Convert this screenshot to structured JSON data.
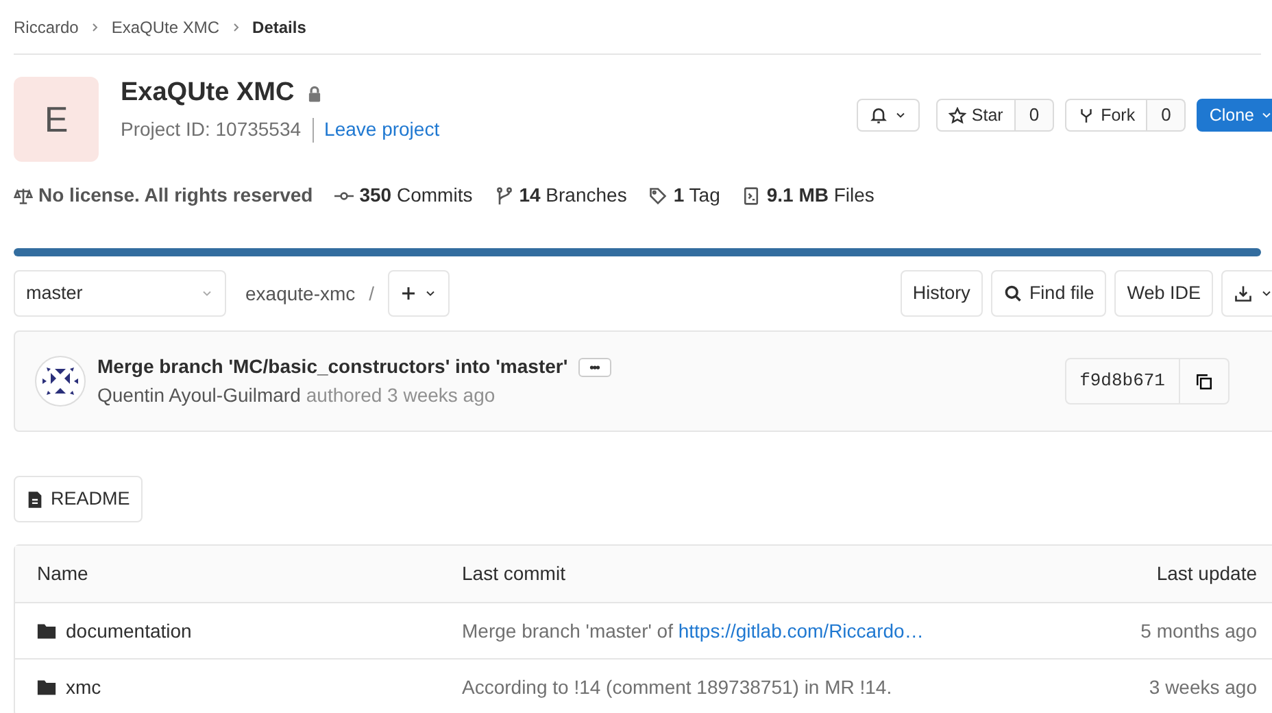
{
  "breadcrumb": [
    {
      "label": "Riccardo",
      "current": false
    },
    {
      "label": "ExaQUte XMC",
      "current": false
    },
    {
      "label": "Details",
      "current": true
    }
  ],
  "project": {
    "avatar_letter": "E",
    "name": "ExaQUte XMC",
    "private": true,
    "id_text": "Project ID: 10735534",
    "leave_link": "Leave project"
  },
  "actions": {
    "star": {
      "label": "Star",
      "count": "0"
    },
    "fork": {
      "label": "Fork",
      "count": "0"
    },
    "clone": "Clone"
  },
  "stats": [
    {
      "kind": "license",
      "value": "No license. All rights reserved"
    },
    {
      "kind": "commits",
      "value": "350",
      "label": "Commits"
    },
    {
      "kind": "branches",
      "value": "14",
      "label": "Branches"
    },
    {
      "kind": "tags",
      "value": "1",
      "label": "Tag"
    },
    {
      "kind": "files",
      "value": "9.1 MB",
      "label": "Files"
    }
  ],
  "toolbar": {
    "branch": "master",
    "path": "exaqute-xmc",
    "separator": "/",
    "buttons": [
      "History",
      "Find file",
      "Web IDE"
    ]
  },
  "last_commit": {
    "title": "Merge branch 'MC/basic_constructors' into 'master'",
    "author": "Quentin Ayoul-Guilmard",
    "time": "authored 3 weeks ago",
    "sha": "f9d8b671"
  },
  "readme_button": "README",
  "table": {
    "columns": [
      "Name",
      "Last commit",
      "Last update"
    ],
    "rows": [
      {
        "name": "documentation",
        "commit": "Merge branch 'master' of ",
        "commit_link": "https://gitlab.com/Riccardo…",
        "updated": "5 months ago"
      },
      {
        "name": "xmc",
        "commit": "According to !14 (comment 189738751) in MR !14.",
        "commit_link": "",
        "updated": "3 weeks ago"
      }
    ]
  }
}
